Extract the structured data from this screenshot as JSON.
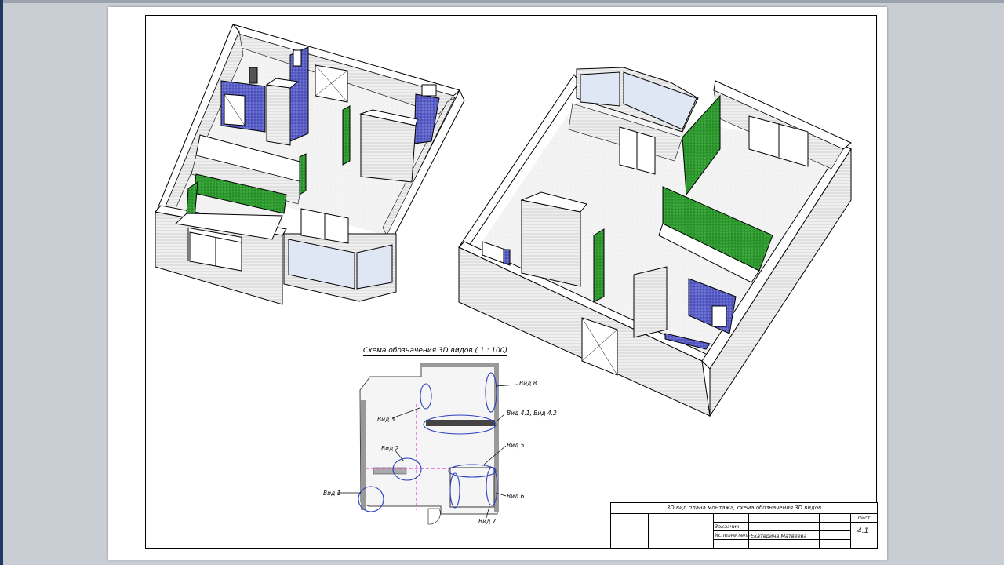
{
  "schema": {
    "title": "Схема обозначения 3D видов ( 1 : 100)",
    "views": {
      "v1": "Вид 1",
      "v2": "Вид 2",
      "v3": "Вид 3",
      "v41": "Вид 4.1, Вид 4.2",
      "v5": "Вид 5",
      "v6": "Вид 6",
      "v7": "Вид 7",
      "v8": "Вид 8"
    }
  },
  "title_block": {
    "sheet_title": "3D вид плана монтажа, схема обозначения 3D видов",
    "customer_label": "Заказчик",
    "executor_label": "Исполнитель",
    "executor_name": "Екатерина Матвеева",
    "sheet_label": "Лист",
    "sheet_number": "4.1"
  },
  "colors": {
    "tile_blue": "#5a5fc8",
    "tile_green": "#2f9a2f",
    "wall_grey": "#e6e6e6",
    "marker_magenta": "#e040e0",
    "cloud_blue": "#2d3fbf"
  }
}
